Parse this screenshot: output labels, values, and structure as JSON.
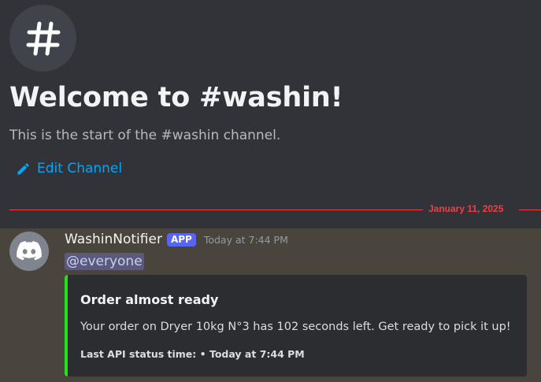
{
  "channel": {
    "hash_symbol": "#",
    "welcome_title": "Welcome to #washin!",
    "welcome_subtitle": "This is the start of the #washin channel.",
    "edit_label": "Edit Channel",
    "edit_icon": "pencil-icon"
  },
  "divider": {
    "date": "January 11, 2025",
    "color": "#f23f43"
  },
  "message": {
    "avatar_icon": "discord-logo-icon",
    "username": "WashinNotifier",
    "badge": "APP",
    "timestamp": "Today at 7:44 PM",
    "mention": "@everyone",
    "embed": {
      "accent_color": "#22e01c",
      "title": "Order almost ready",
      "description": "Your order on Dryer 10kg N°3 has 102 seconds left. Get ready to pick it up!",
      "footer": "Last API status time: • Today at 7:44 PM"
    }
  },
  "colors": {
    "background": "#313338",
    "highlight": "#4a453c",
    "link": "#00a8fc",
    "app_badge": "#5865f2"
  }
}
